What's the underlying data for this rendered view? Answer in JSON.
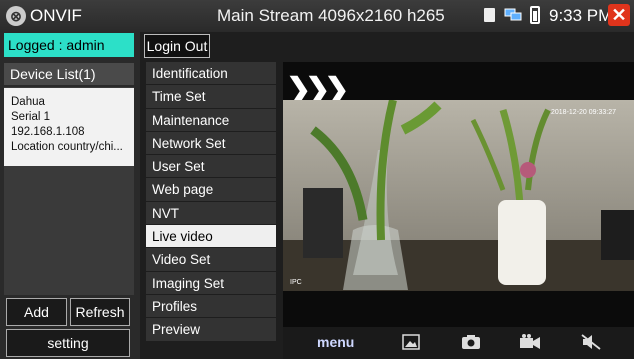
{
  "titlebar": {
    "app_name": "ONVIF",
    "title": "Main Stream 4096x2160 h265",
    "time": "9:33 PM",
    "close_symbol": "✕"
  },
  "login": {
    "status": "Logged : admin",
    "logout_label": "Login Out"
  },
  "device_list": {
    "header": "Device List(1)",
    "items": [
      {
        "name": "Dahua",
        "serial": "Serial 1",
        "ip": "192.168.1.108",
        "location": "Location country/chi..."
      }
    ]
  },
  "buttons": {
    "add": "Add",
    "refresh": "Refresh",
    "setting": "setting"
  },
  "menu": {
    "items": [
      "Identification",
      "Time Set",
      "Maintenance",
      "Network Set",
      "User Set",
      "Web page",
      "NVT",
      "Live video",
      "Video Set",
      "Imaging Set",
      "Profiles",
      "Preview"
    ],
    "selected": "Live video"
  },
  "video": {
    "timestamp": "2018-12-20 09:33:27",
    "channel_label": "IPC"
  },
  "toolbar": {
    "menu_label": "menu",
    "icons": [
      "picture-icon",
      "camera-icon",
      "record-icon",
      "mute-icon"
    ]
  },
  "colors": {
    "accent": "#2ce0c8",
    "close": "#e0341c"
  }
}
